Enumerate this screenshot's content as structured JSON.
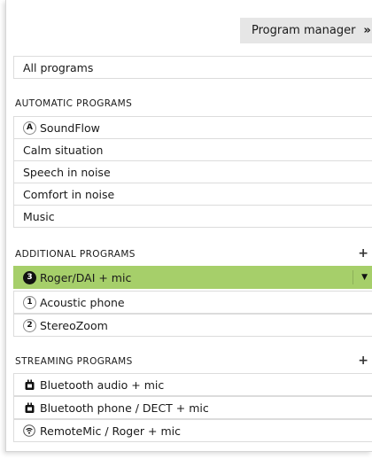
{
  "header": {
    "program_manager_label": "Program manager",
    "program_manager_chevron": "»"
  },
  "all_programs": {
    "label": "All programs"
  },
  "automatic": {
    "title": "AUTOMATIC PROGRAMS",
    "items": [
      {
        "badge": "A",
        "label": "SoundFlow"
      },
      {
        "label": "Calm situation"
      },
      {
        "label": "Speech in noise"
      },
      {
        "label": "Comfort in noise"
      },
      {
        "label": "Music"
      }
    ]
  },
  "additional": {
    "title": "ADDITIONAL PROGRAMS",
    "add": "+",
    "items": [
      {
        "badge": "3",
        "label": "Roger/DAI + mic",
        "selected": true,
        "dropdown": "▼"
      },
      {
        "badge": "1",
        "label": "Acoustic phone"
      },
      {
        "badge": "2",
        "label": "StereoZoom"
      }
    ]
  },
  "streaming": {
    "title": "STREAMING PROGRAMS",
    "add": "+",
    "items": [
      {
        "icon": "bluetooth-device-icon",
        "label": "Bluetooth audio + mic"
      },
      {
        "icon": "bluetooth-device-icon",
        "label": "Bluetooth phone / DECT + mic"
      },
      {
        "icon": "wireless-mic-icon",
        "label": "RemoteMic / Roger + mic"
      }
    ]
  },
  "colors": {
    "selected_row": "#a6cf6a",
    "header_button": "#e6e6e6"
  }
}
